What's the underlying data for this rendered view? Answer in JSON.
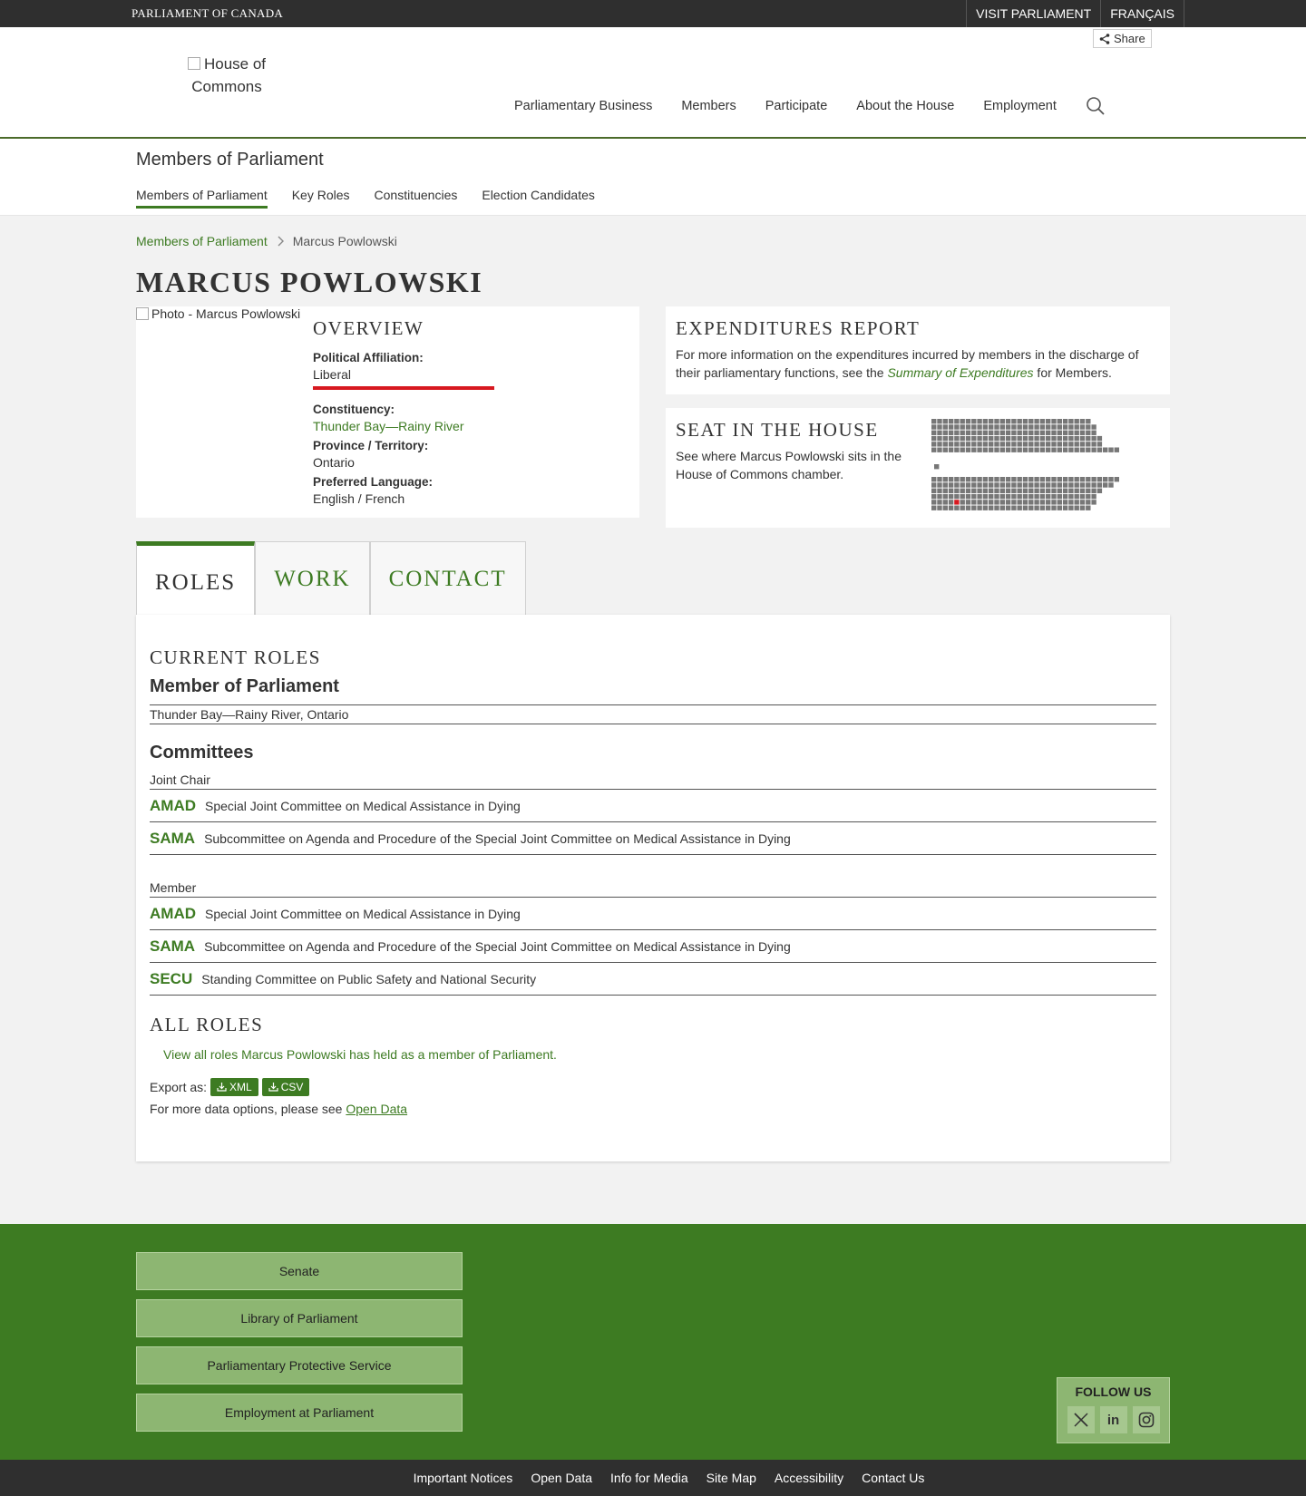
{
  "topbar": {
    "brand": "PARLIAMENT OF CANADA",
    "links": [
      "VISIT PARLIAMENT",
      "FRANÇAIS"
    ]
  },
  "header": {
    "share": "Share",
    "logo_alt": "House of Commons",
    "nav": [
      "Parliamentary Business",
      "Members",
      "Participate",
      "About the House",
      "Employment"
    ]
  },
  "subnav": {
    "title": "Members of Parliament",
    "links": [
      "Members of Parliament",
      "Key Roles",
      "Constituencies",
      "Election Candidates"
    ]
  },
  "breadcrumb": {
    "parent": "Members of Parliament",
    "current": "Marcus Powlowski"
  },
  "member": {
    "name": "MARCUS POWLOWSKI",
    "photo_alt": "Photo - Marcus Powlowski",
    "party_color": "#d71920"
  },
  "overview": {
    "heading": "OVERVIEW",
    "affiliation_label": "Political Affiliation:",
    "affiliation": "Liberal",
    "constituency_label": "Constituency:",
    "constituency": "Thunder Bay—Rainy River",
    "province_label": "Province / Territory:",
    "province": "Ontario",
    "language_label": "Preferred Language:",
    "language": "English / French"
  },
  "expenditures": {
    "heading": "EXPENDITURES REPORT",
    "text_before": "For more information on the expenditures incurred by members in the discharge of their parliamentary functions, see the ",
    "link": "Summary of Expenditures",
    "text_after": " for Members."
  },
  "seat": {
    "heading": "SEAT IN THE HOUSE",
    "text": "See where Marcus Powlowski sits in the House of Commons chamber."
  },
  "tabs": [
    "ROLES",
    "WORK",
    "CONTACT"
  ],
  "roles": {
    "current_heading": "CURRENT ROLES",
    "role_title": "Member of Parliament",
    "role_detail": "Thunder Bay—Rainy River, Ontario",
    "committees_heading": "Committees",
    "joint_chair_label": "Joint Chair",
    "joint_chair": [
      {
        "code": "AMAD",
        "name": "Special Joint Committee on Medical Assistance in Dying"
      },
      {
        "code": "SAMA",
        "name": "Subcommittee on Agenda and Procedure of the Special Joint Committee on Medical Assistance in Dying"
      }
    ],
    "member_label": "Member",
    "member": [
      {
        "code": "AMAD",
        "name": "Special Joint Committee on Medical Assistance in Dying"
      },
      {
        "code": "SAMA",
        "name": "Subcommittee on Agenda and Procedure of the Special Joint Committee on Medical Assistance in Dying"
      },
      {
        "code": "SECU",
        "name": "Standing Committee on Public Safety and National Security"
      }
    ],
    "all_heading": "ALL ROLES",
    "view_all": "View all roles Marcus Powlowski has held as a member of Parliament.",
    "export_label": "Export as:",
    "export_xml": "XML",
    "export_csv": "CSV",
    "more_data": "For more data options, please see ",
    "open_data": "Open Data"
  },
  "footer": {
    "buttons": [
      "Senate",
      "Library of Parliament",
      "Parliamentary Protective Service",
      "Employment at Parliament"
    ],
    "follow": "FOLLOW US",
    "social_icons": [
      "x-icon",
      "linkedin-icon",
      "instagram-icon"
    ],
    "bottom_links": [
      "Important Notices",
      "Open Data",
      "Info for Media",
      "Site Map",
      "Accessibility",
      "Contact Us"
    ]
  }
}
